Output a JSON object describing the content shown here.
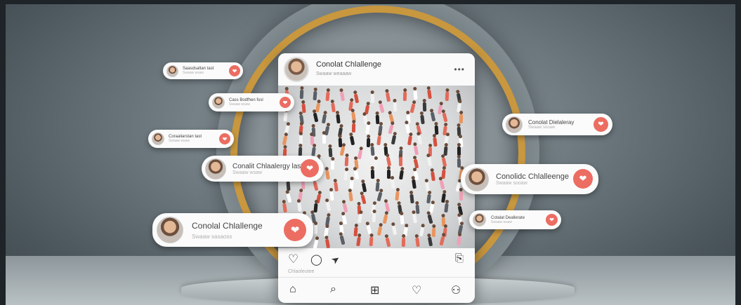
{
  "post": {
    "title": "Conolat Chlallenge",
    "subtitle": "Swaaw weaaaw",
    "more": "•••",
    "caption": "Chlaoleutee"
  },
  "icons": {
    "like": "♡",
    "comment": "◯",
    "share": "➤",
    "bookmark": "⎘",
    "home": "⌂",
    "search": "⌕",
    "add": "⊞",
    "activity": "♡",
    "profile": "⚇",
    "heart_badge": "❤"
  },
  "notifications": [
    {
      "title": "Saasdsaltan tast",
      "sub": "Swaaw wsaw"
    },
    {
      "title": "Cass Bodfhen fosl",
      "sub": "Swaaw wsaw"
    },
    {
      "title": "Coraaliarstan tast",
      "sub": "Swaaw wsaw"
    },
    {
      "title": "Conolat Dielaleray",
      "sub": "Swaaw sooaw"
    },
    {
      "title": "Conalit Chlaalergy last",
      "sub": "Swaaw wsaw"
    },
    {
      "title": "Conolidc Chlalleenge",
      "sub": "Swaaw sooaw"
    },
    {
      "title": "Cotalat Deallerate",
      "sub": "Swaaw wsaw"
    },
    {
      "title": "Conolal Chlallenge",
      "sub": "Swaaw sasaoss"
    }
  ],
  "colors": {
    "accent_gold": "#c8973e",
    "heart_red": "#ec6d62"
  }
}
